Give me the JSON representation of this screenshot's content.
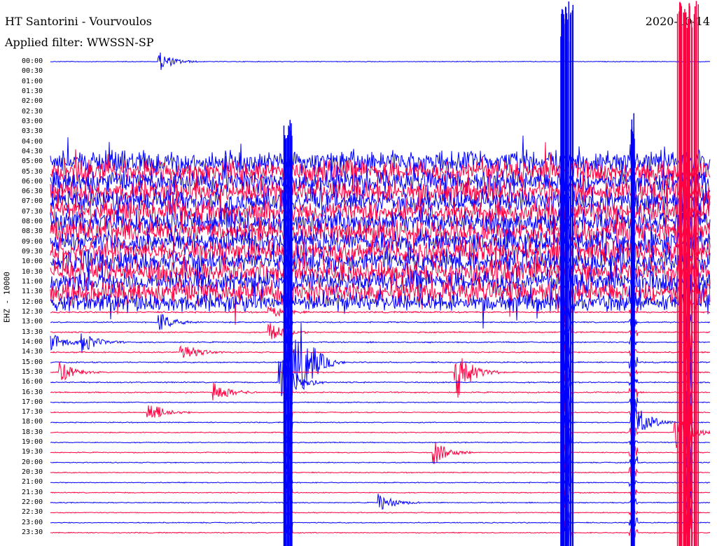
{
  "header": {
    "station": "HT Santorini - Vourvoulos",
    "filter": "Applied filter: WWSSN-SP",
    "date": "2020-10-14"
  },
  "chart_data": {
    "type": "line",
    "title": "HT Santorini - Vourvoulos",
    "subtitle": "Applied filter: WWSSN-SP",
    "ylabel": "EHZ - 10000",
    "colors": [
      "#0000ff",
      "#ff0040"
    ],
    "rows": [
      "00:00",
      "00:30",
      "01:00",
      "01:30",
      "02:00",
      "02:30",
      "03:00",
      "03:30",
      "04:00",
      "04:30",
      "05:00",
      "05:30",
      "06:00",
      "06:30",
      "07:00",
      "07:30",
      "08:00",
      "08:30",
      "09:00",
      "09:30",
      "10:00",
      "10:30",
      "11:00",
      "11:30",
      "12:00",
      "12:30",
      "13:00",
      "13:30",
      "14:00",
      "14:30",
      "15:00",
      "15:30",
      "16:00",
      "16:30",
      "17:00",
      "17:30",
      "18:00",
      "18:30",
      "19:00",
      "19:30",
      "20:00",
      "20:30",
      "21:00",
      "21:30",
      "22:00",
      "22:30",
      "23:00",
      "23:30"
    ],
    "row_noise_level": [
      0.15,
      0,
      0,
      0,
      0,
      0,
      0,
      0,
      0,
      0,
      1,
      1,
      1,
      1,
      1,
      1,
      1,
      1,
      1,
      1,
      1,
      1,
      1,
      1,
      0.8,
      0.3,
      0.25,
      0.25,
      0.25,
      0.25,
      0.25,
      0.25,
      0.25,
      0.25,
      0.2,
      0.2,
      0.2,
      0.2,
      0.2,
      0.2,
      0.2,
      0.2,
      0.2,
      0.2,
      0.2,
      0.2,
      0.2,
      0.2
    ],
    "events": [
      {
        "row": 0,
        "minute": 5,
        "amp": 0.8
      },
      {
        "row": 25,
        "minute": 10,
        "amp": 0.6
      },
      {
        "row": 26,
        "minute": 5,
        "amp": 0.8
      },
      {
        "row": 27,
        "minute": 10,
        "amp": 0.8
      },
      {
        "row": 28,
        "minute": 0,
        "amp": 1
      },
      {
        "row": 28,
        "minute": 1.5,
        "amp": 0.9
      },
      {
        "row": 29,
        "minute": 6,
        "amp": 0.9
      },
      {
        "row": 30,
        "minute": 11,
        "amp": 3
      },
      {
        "row": 30,
        "minute": 11.5,
        "amp": 2
      },
      {
        "row": 31,
        "minute": 0.5,
        "amp": 0.9
      },
      {
        "row": 31,
        "minute": 18.5,
        "amp": 2.5
      },
      {
        "row": 32,
        "minute": 10.5,
        "amp": 2.5
      },
      {
        "row": 33,
        "minute": 7.5,
        "amp": 0.9
      },
      {
        "row": 35,
        "minute": 4.5,
        "amp": 1
      },
      {
        "row": 36,
        "minute": 26.5,
        "amp": 2
      },
      {
        "row": 37,
        "minute": 28.5,
        "amp": 1.5
      },
      {
        "row": 39,
        "minute": 17.5,
        "amp": 1
      },
      {
        "row": 44,
        "minute": 15,
        "amp": 0.8
      }
    ],
    "large_events": [
      {
        "minute": 10.8,
        "amp": 12
      },
      {
        "minute": 23.5,
        "amp": 18
      },
      {
        "minute": 29,
        "amp": 30
      },
      {
        "minute": 26.5,
        "amp": 6
      }
    ]
  }
}
